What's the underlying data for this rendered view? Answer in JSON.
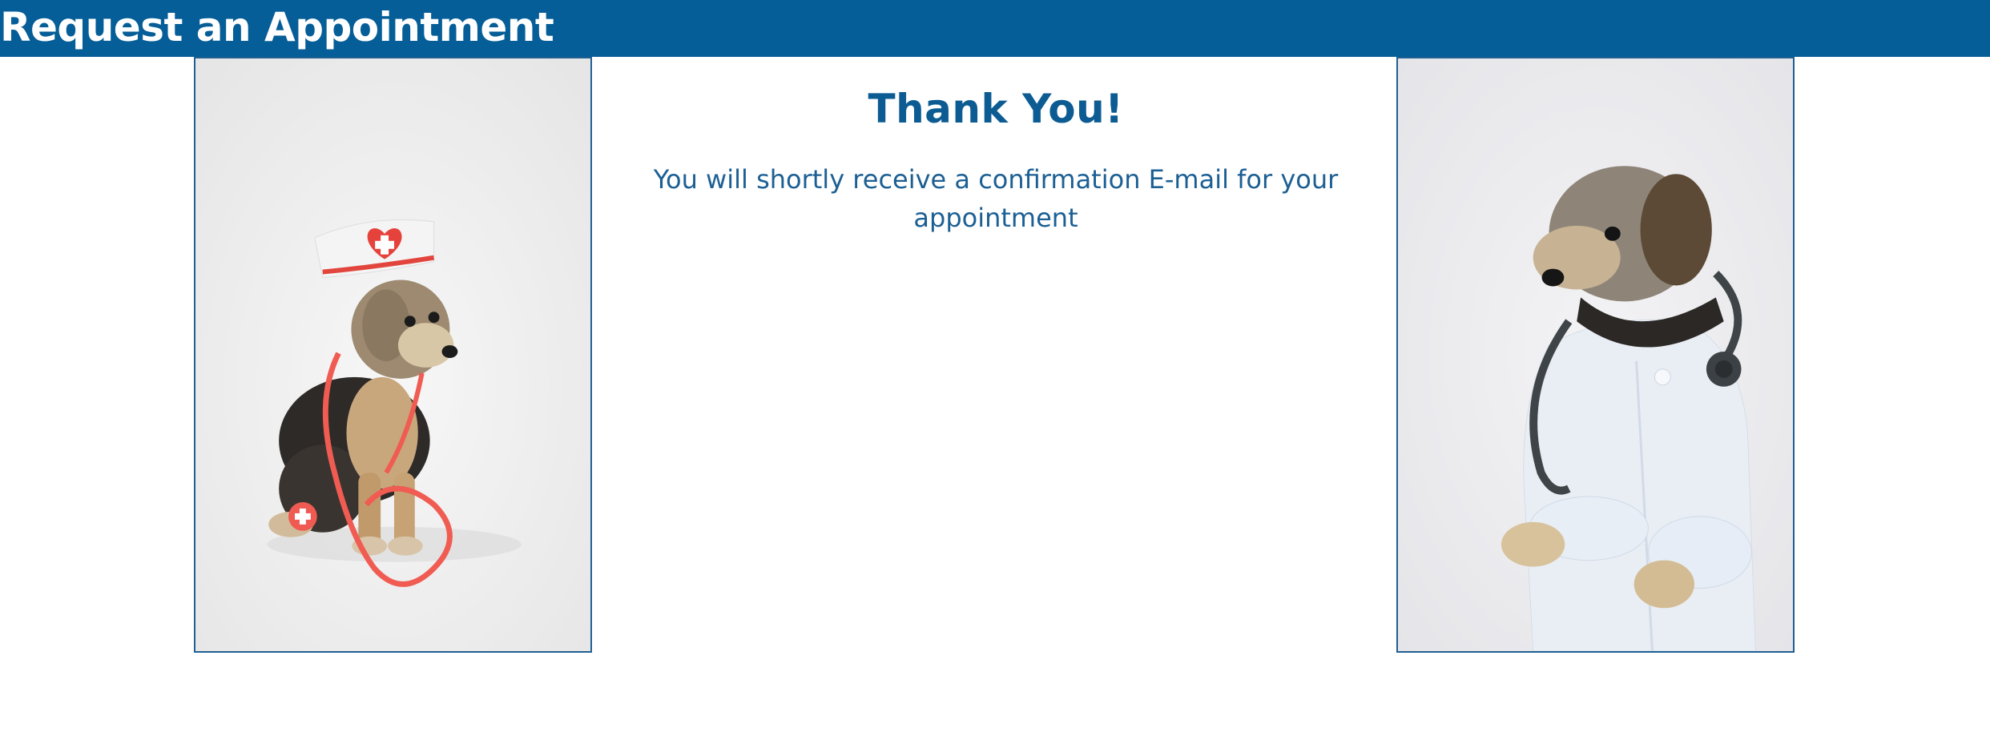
{
  "header": {
    "title": "Request an Appointment"
  },
  "confirmation": {
    "heading": "Thank You!",
    "message": "You will shortly receive a confirmation E-mail for your appointment"
  },
  "images": {
    "left": "dog-nurse-photo",
    "right": "dog-doctor-photo"
  },
  "colors": {
    "header_bg": "#055e97",
    "text_blue": "#0c5c93",
    "frame_border": "#1f5f93"
  }
}
